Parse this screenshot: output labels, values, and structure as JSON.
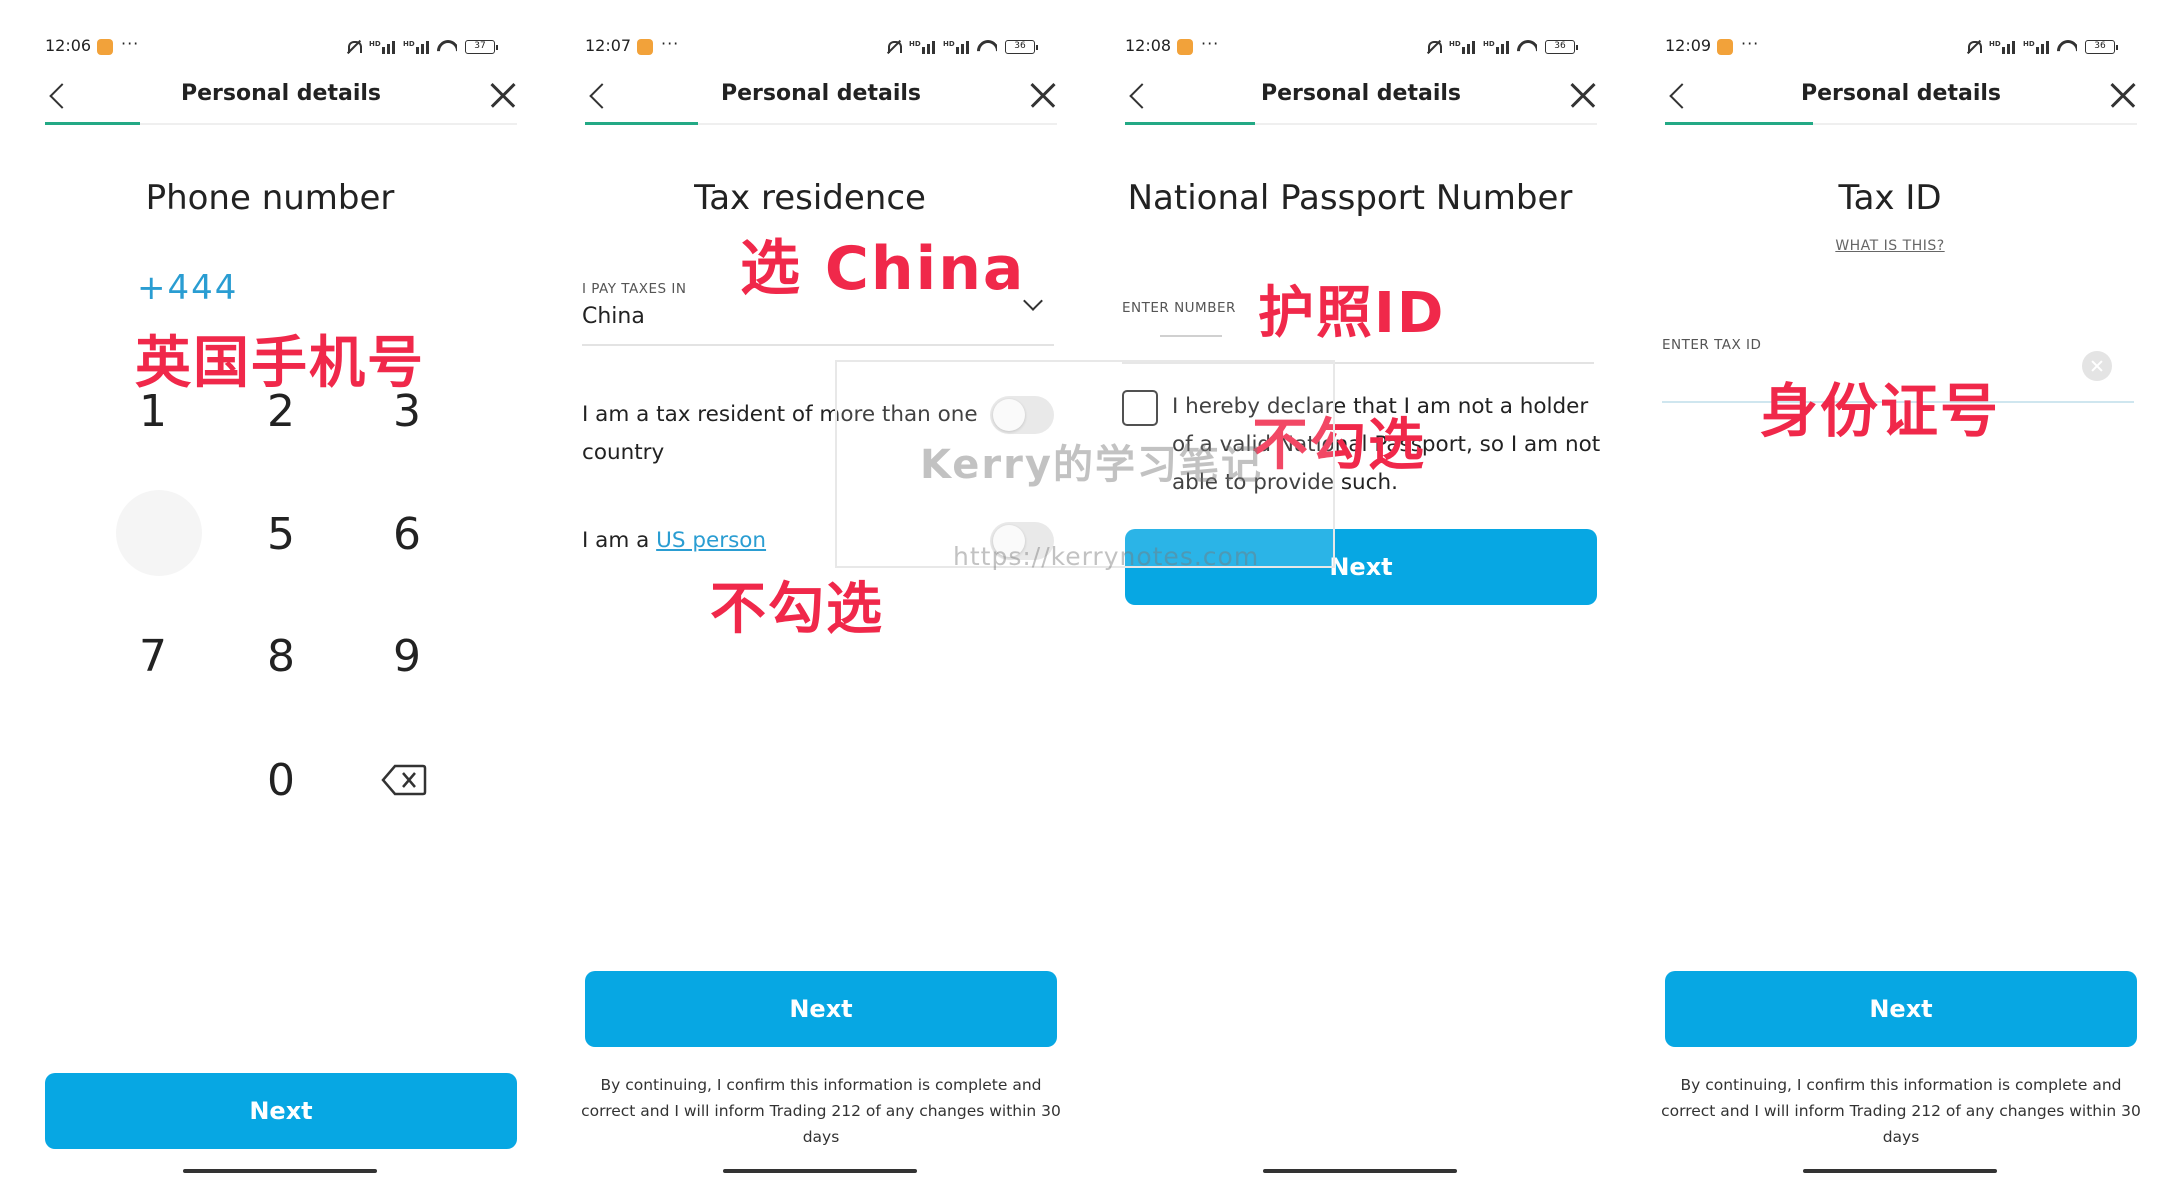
{
  "status_bars": [
    {
      "time": "12:06",
      "battery": "37"
    },
    {
      "time": "12:07",
      "battery": "36"
    },
    {
      "time": "12:08",
      "battery": "36"
    },
    {
      "time": "12:09",
      "battery": "36"
    }
  ],
  "status_misc": {
    "dots": "···",
    "signal_label": "HD"
  },
  "header": {
    "title": "Personal details"
  },
  "screen1": {
    "title": "Phone number",
    "phone_value": "+444",
    "note": "英国手机号",
    "keys": [
      "1",
      "2",
      "3",
      "5",
      "6",
      "7",
      "8",
      "9",
      "0"
    ],
    "next": "Next"
  },
  "screen2": {
    "title": "Tax residence",
    "note_top": "选 China",
    "pay_taxes_label": "I PAY TAXES IN",
    "country": "China",
    "multi_country_text": "I am a tax resident of more than one country",
    "us_person_prefix": "I am a ",
    "us_person_link": "US person",
    "note_bottom": "不勾选",
    "next": "Next",
    "disclaimer": "By continuing, I confirm this information is complete and correct and I will inform Trading 212 of any changes within 30 days"
  },
  "screen3": {
    "title": "National Passport Number",
    "enter_label": "ENTER NUMBER",
    "note_top": "护照ID",
    "declare_text": "I hereby declare that I am not a holder of a valid National Passport, so I am not able to provide such.",
    "note_middle": "不勾选",
    "next": "Next"
  },
  "screen4": {
    "title": "Tax ID",
    "what_link": "WHAT IS THIS?",
    "enter_label": "ENTER TAX ID",
    "note": "身份证号",
    "next": "Next",
    "disclaimer": "By continuing, I confirm this information is complete and correct and I will inform Trading 212 of any changes within 30 days"
  },
  "watermark": {
    "name": "Kerry的学习笔记",
    "url": "https://kerrynotes.com"
  },
  "colors": {
    "accent": "#07a7e3",
    "progress": "#23a985",
    "note": "#f0284a",
    "link": "#2a9dd2"
  }
}
